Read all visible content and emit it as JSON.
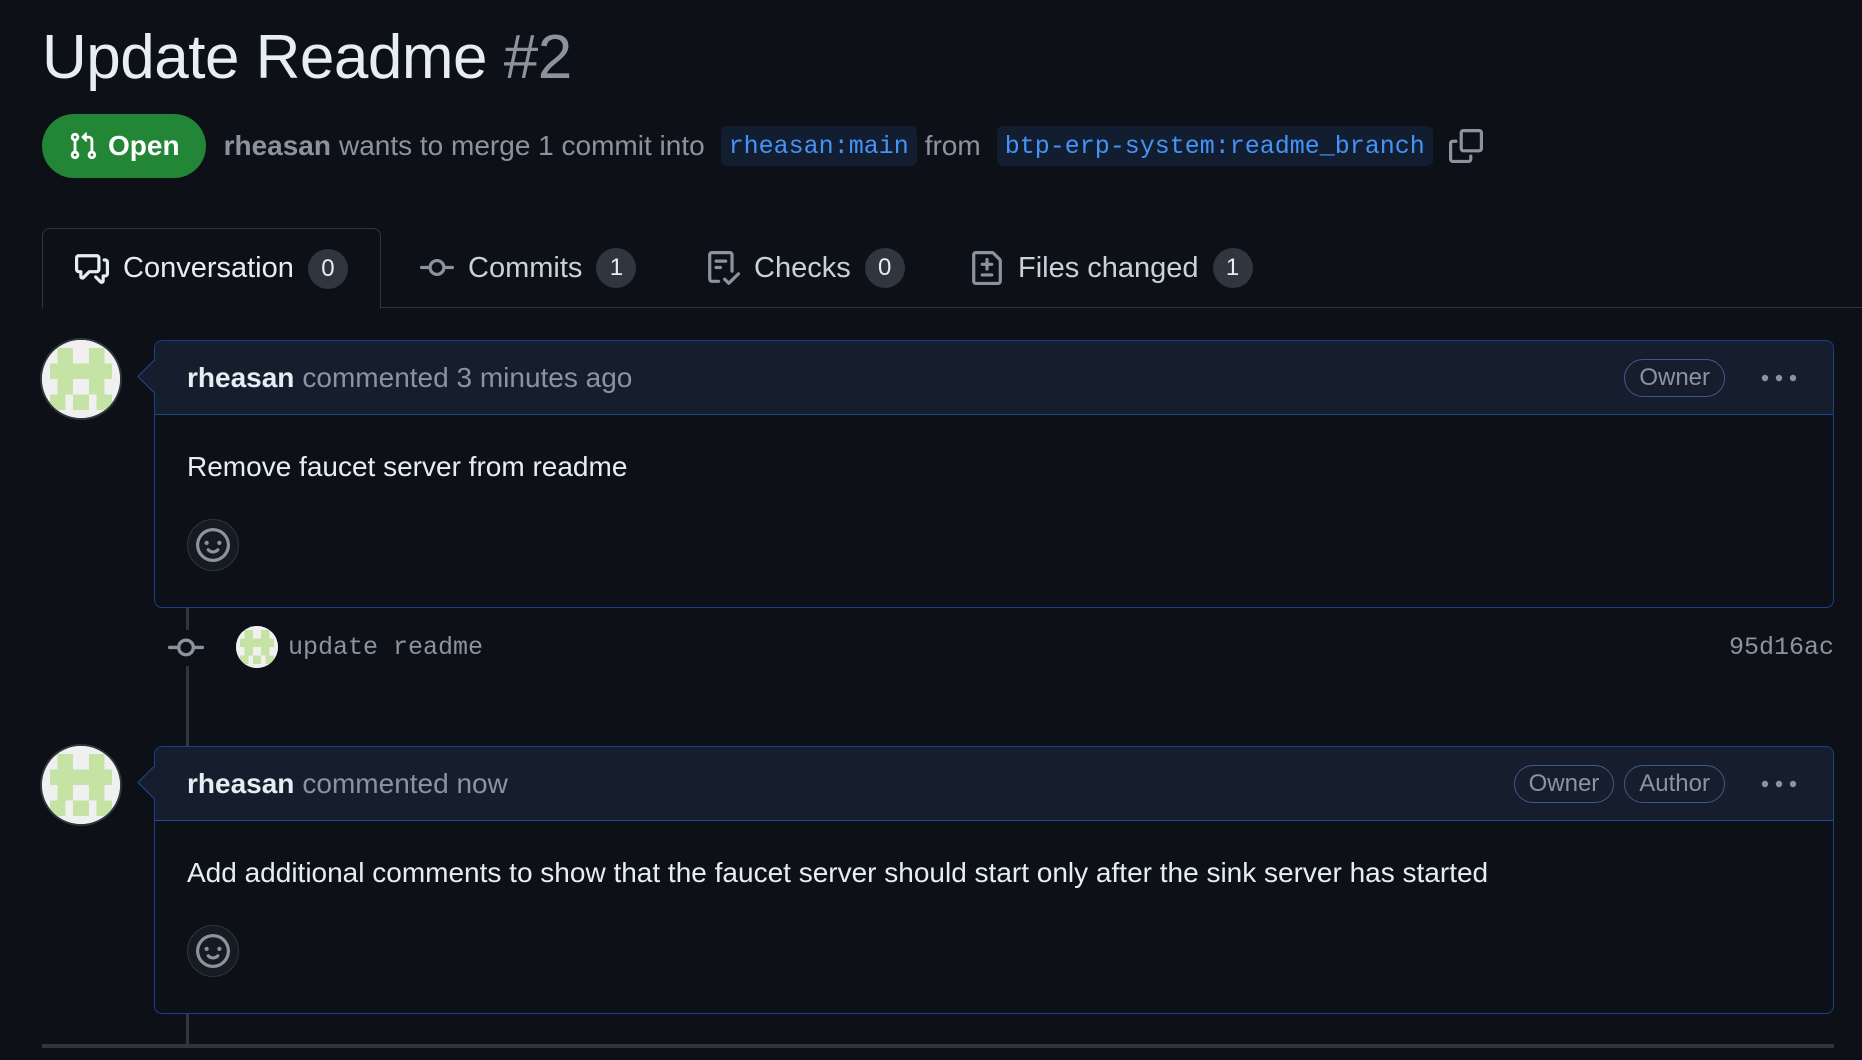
{
  "pr": {
    "title": "Update Readme",
    "number": "#2",
    "state": "Open",
    "author": "rheasan",
    "merge_text": "wants to merge 1 commit into",
    "base_branch": "rheasan:main",
    "from_text": "from",
    "head_branch": "btp-erp-system:readme_branch"
  },
  "tabs": [
    {
      "label": "Conversation",
      "count": "0",
      "icon": "comment-discussion-icon"
    },
    {
      "label": "Commits",
      "count": "1",
      "icon": "git-commit-icon"
    },
    {
      "label": "Checks",
      "count": "0",
      "icon": "checklist-icon"
    },
    {
      "label": "Files changed",
      "count": "1",
      "icon": "file-diff-icon"
    }
  ],
  "comments": [
    {
      "author": "rheasan",
      "action": "commented 3 minutes ago",
      "roles": [
        "Owner"
      ],
      "body": "Remove faucet server from readme"
    },
    {
      "author": "rheasan",
      "action": "commented now",
      "roles": [
        "Owner",
        "Author"
      ],
      "body": "Add additional comments to show that the faucet server should start only after the sink server has started"
    }
  ],
  "commit": {
    "message": "update readme",
    "sha": "95d16ac"
  },
  "colors": {
    "background": "#0d1117",
    "open_green": "#238636",
    "branch_blue": "#4493f8",
    "comment_border": "#1f6feb",
    "avatar_green": "#c5e3a5"
  }
}
